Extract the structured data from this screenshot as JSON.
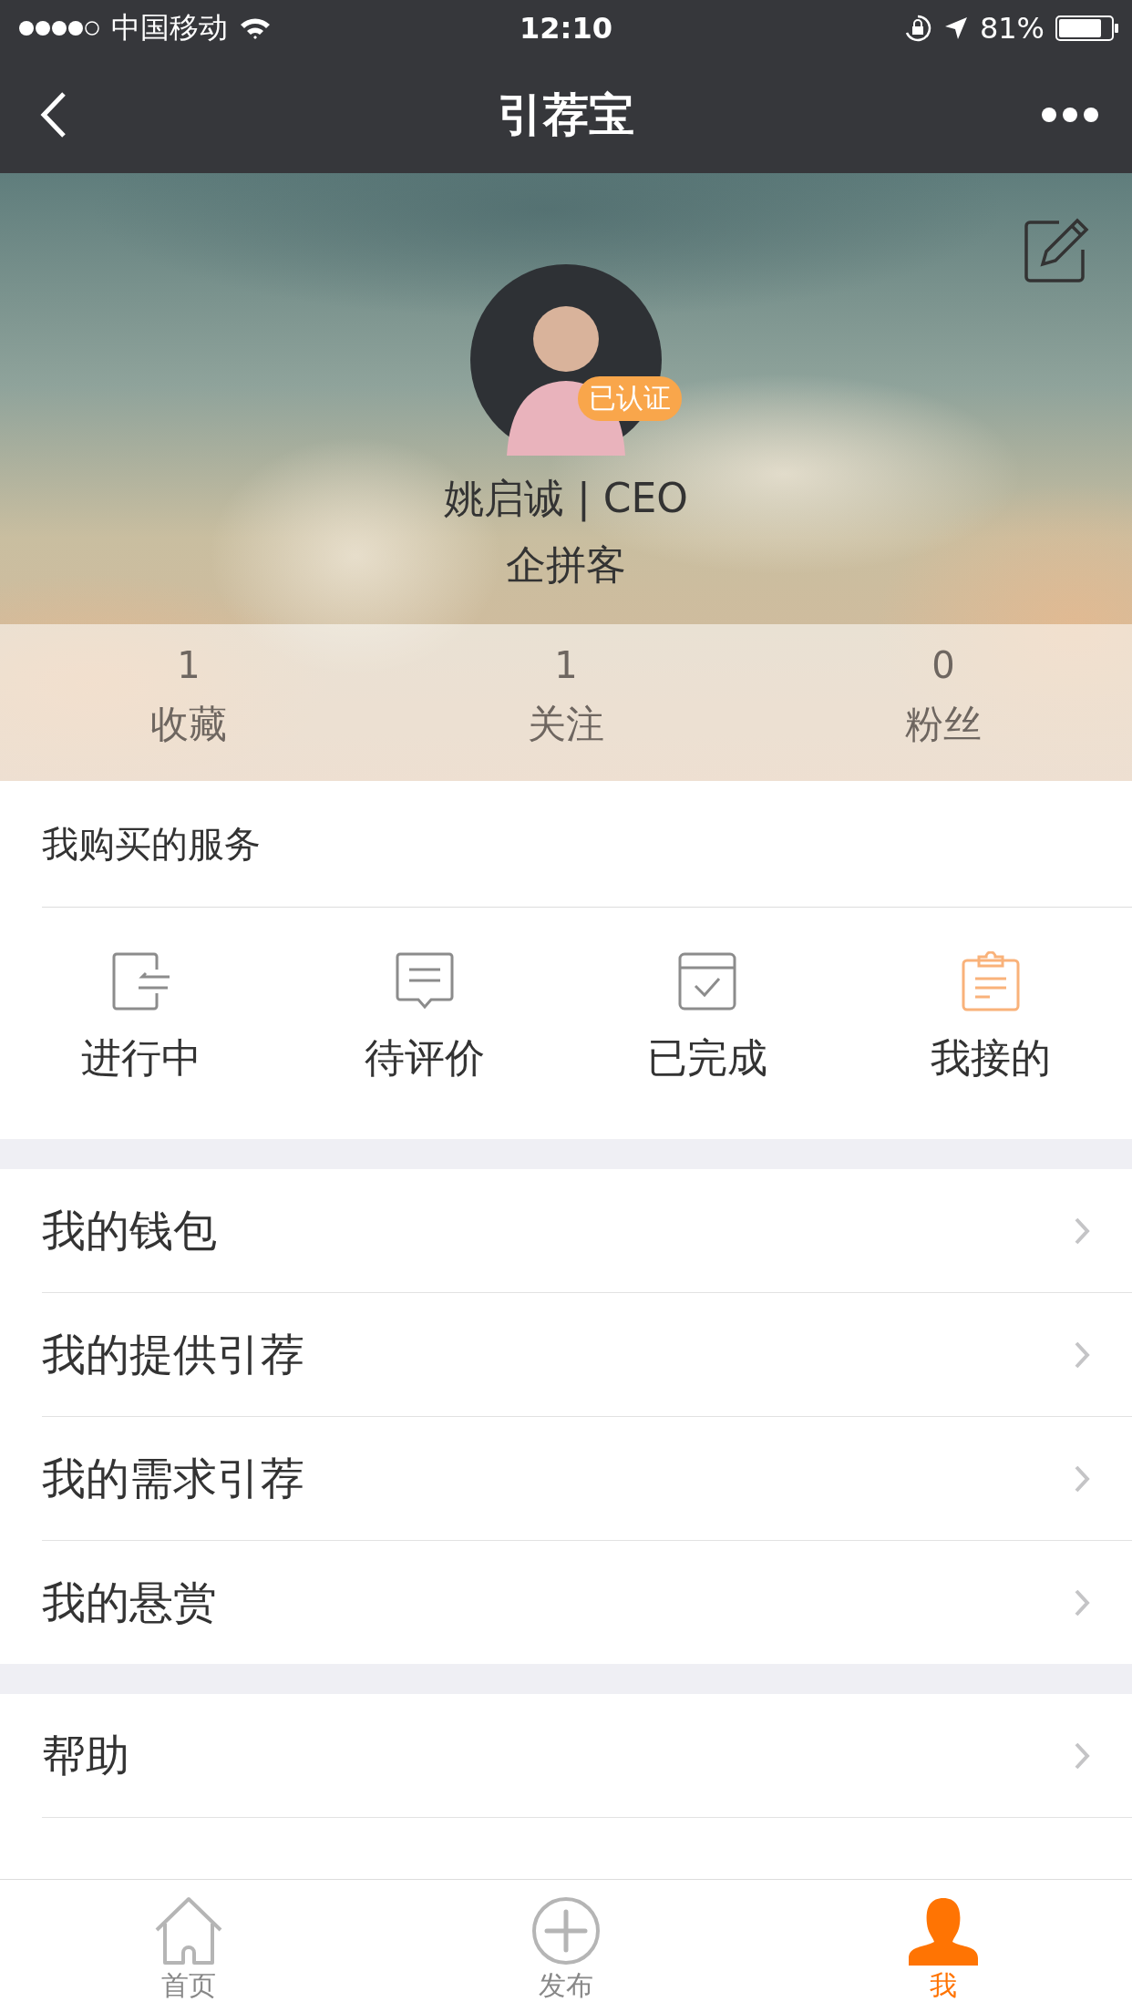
{
  "status_bar": {
    "carrier": "中国移动",
    "time": "12:10",
    "battery": "81%"
  },
  "nav": {
    "title": "引荐宝"
  },
  "profile": {
    "badge": "已认证",
    "name": "姚启诚 | CEO",
    "company": "企拼客"
  },
  "stats": [
    {
      "count": "1",
      "label": "收藏"
    },
    {
      "count": "1",
      "label": "关注"
    },
    {
      "count": "0",
      "label": "粉丝"
    }
  ],
  "services": {
    "title": "我购买的服务",
    "items": [
      {
        "kind": "in-progress",
        "label": "进行中",
        "highlighted": false
      },
      {
        "kind": "review",
        "label": "待评价",
        "highlighted": false
      },
      {
        "kind": "done",
        "label": "已完成",
        "highlighted": false
      },
      {
        "kind": "clipboard",
        "label": "我接的",
        "highlighted": true
      }
    ]
  },
  "menu_groups": [
    [
      {
        "label": "我的钱包"
      },
      {
        "label": "我的提供引荐"
      },
      {
        "label": "我的需求引荐"
      },
      {
        "label": "我的悬赏"
      }
    ],
    [
      {
        "label": "帮助"
      }
    ]
  ],
  "tab_bar": [
    {
      "kind": "home",
      "label": "首页",
      "selected": false
    },
    {
      "kind": "add",
      "label": "发布",
      "selected": false
    },
    {
      "kind": "person",
      "label": "我",
      "selected": true
    }
  ]
}
